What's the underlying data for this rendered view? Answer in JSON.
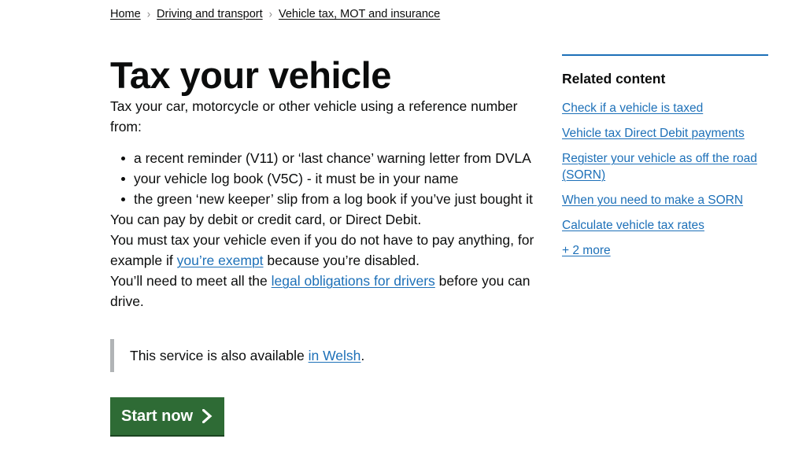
{
  "breadcrumb": {
    "separator": "›",
    "items": [
      {
        "label": "Home"
      },
      {
        "label": "Driving and transport"
      },
      {
        "label": "Vehicle tax, MOT and insurance"
      }
    ]
  },
  "main": {
    "title": "Tax your vehicle",
    "intro": "Tax your car, motorcycle or other vehicle using a reference number from:",
    "bullets": [
      "a recent reminder (V11) or ‘last chance’ warning letter from DVLA",
      "your vehicle log book (V5C) - it must be in your name",
      "the green ‘new keeper’ slip from a log book if you’ve just bought it"
    ],
    "pay_paragraph": "You can pay by debit or credit card, or Direct Debit.",
    "must_tax": {
      "before": "You must tax your vehicle even if you do not have to pay anything, for example if ",
      "link": "you’re exempt",
      "after": " because you’re disabled."
    },
    "legal": {
      "before": "You’ll need to meet all the ",
      "link": "legal obligations for drivers",
      "after": " before you can drive."
    },
    "inset": {
      "before": "This service is also available ",
      "link": "in Welsh",
      "after": "."
    },
    "start_button": {
      "label": "Start now",
      "icon": "chevron-right-icon"
    }
  },
  "sidebar": {
    "heading": "Related content",
    "links": [
      {
        "label": "Check if a vehicle is taxed",
        "visited": false
      },
      {
        "label": "Vehicle tax Direct Debit payments",
        "visited": false
      },
      {
        "label": "Register your vehicle as off the road (SORN)",
        "visited": false
      },
      {
        "label": "When you need to make a SORN",
        "visited": false
      },
      {
        "label": "Calculate vehicle tax rates",
        "visited": false
      }
    ],
    "more_label": "+ 2 more"
  },
  "colors": {
    "link": "#1d70b8",
    "link_visited": "#4c2c92",
    "text": "#0b0c0c",
    "button_green": "#2e6b35",
    "button_shadow": "#1b4420",
    "inset_bar": "#b1b4b6",
    "sidebar_rule": "#1d70b8"
  }
}
